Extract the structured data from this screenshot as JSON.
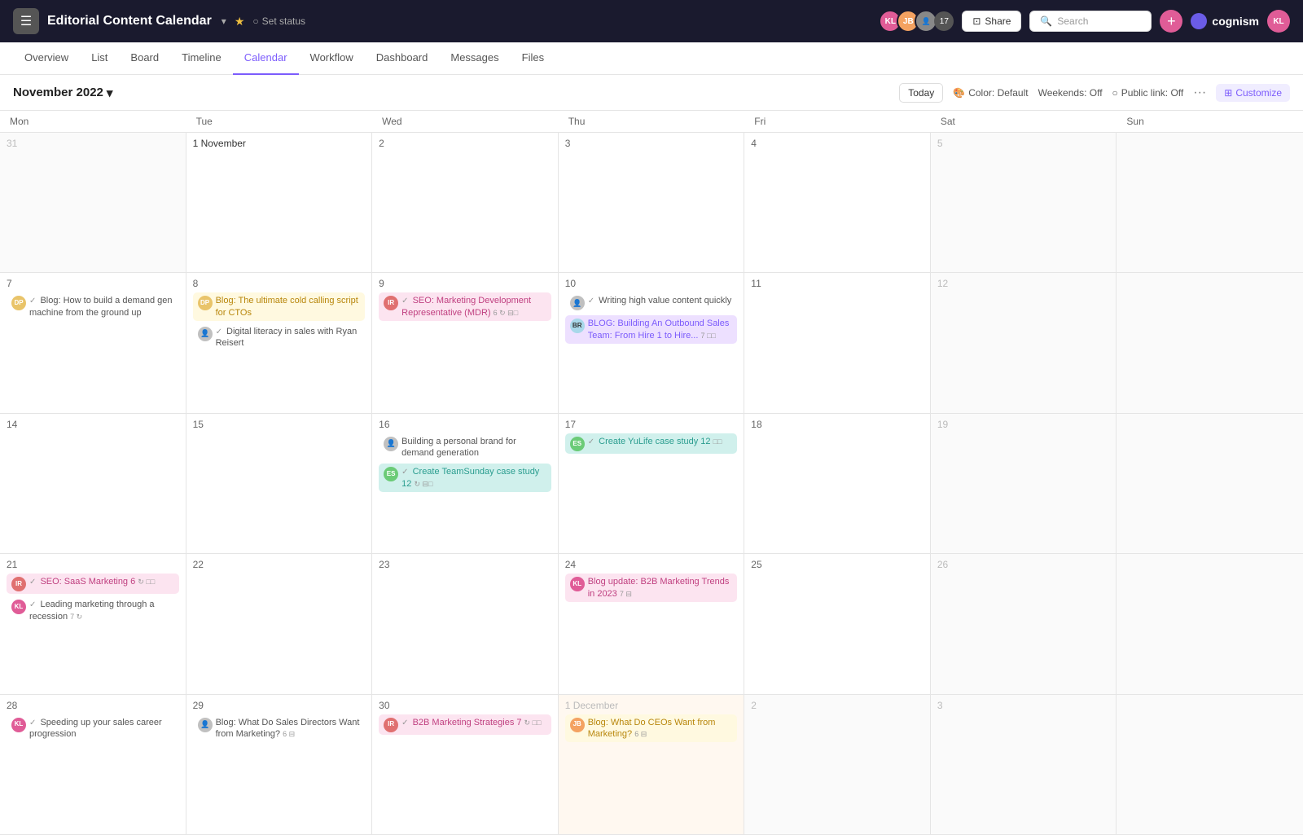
{
  "header": {
    "app_icon": "☰",
    "title": "Editorial Content Calendar",
    "set_status": "Set status",
    "star": "★",
    "share_label": "Share",
    "search_placeholder": "Search",
    "add_icon": "+",
    "brand_name": "cognism",
    "user_initials": "KL",
    "avatar_count": "17"
  },
  "nav": {
    "tabs": [
      "Overview",
      "List",
      "Board",
      "Timeline",
      "Calendar",
      "Workflow",
      "Dashboard",
      "Messages",
      "Files"
    ],
    "active": "Calendar"
  },
  "toolbar": {
    "month": "November 2022",
    "today": "Today",
    "color": "Color: Default",
    "weekends": "Weekends: Off",
    "public_link": "Public link: Off",
    "customize": "Customize"
  },
  "day_headers": [
    "Mon",
    "Tue",
    "Wed",
    "Thu",
    "Fri",
    "Sat",
    "Sun"
  ],
  "weeks": [
    {
      "days": [
        {
          "num": "31",
          "outside": true,
          "events": []
        },
        {
          "num": "1 November",
          "events": []
        },
        {
          "num": "2",
          "events": []
        },
        {
          "num": "3",
          "events": []
        },
        {
          "num": "4",
          "events": []
        },
        {
          "num": "5",
          "outside": true,
          "events": []
        },
        {
          "num": "",
          "outside": true,
          "events": []
        }
      ]
    },
    {
      "days": [
        {
          "num": "7",
          "events": [
            {
              "type": "plain",
              "avatar": "dp",
              "avatar_class": "av-dp",
              "text": "Blog: How to build a demand gen machine from the ground up",
              "check": true
            }
          ]
        },
        {
          "num": "8",
          "events": [
            {
              "type": "yellow",
              "avatar": "dp",
              "avatar_class": "av-dp",
              "text": "Blog: The ultimate cold calling script for CTOs",
              "check": false
            },
            {
              "type": "plain",
              "avatar": "photo",
              "text": "Digital literacy in sales with Ryan Reisert",
              "check": true
            }
          ]
        },
        {
          "num": "9",
          "events": [
            {
              "type": "pink",
              "avatar": "ir",
              "avatar_class": "av-ir",
              "text": "SEO: Marketing Development Representative (MDR)",
              "check": true,
              "num": "6",
              "icons": "⊟□"
            }
          ]
        },
        {
          "num": "10",
          "events": [
            {
              "type": "plain",
              "avatar": "photo",
              "text": "Writing high value content quickly",
              "check": true
            },
            {
              "type": "purple",
              "avatar": "br",
              "avatar_class": "av-br",
              "text": "BLOG: Building An Outbound Sales Team: From Hire 1 to Hire...",
              "check": false,
              "num": "7",
              "icons": "□□"
            }
          ]
        },
        {
          "num": "11",
          "events": []
        },
        {
          "num": "12",
          "outside": true,
          "events": []
        },
        {
          "num": "",
          "outside": true,
          "events": []
        }
      ]
    },
    {
      "days": [
        {
          "num": "14",
          "events": []
        },
        {
          "num": "15",
          "events": []
        },
        {
          "num": "16",
          "events": [
            {
              "type": "plain",
              "avatar": "photo",
              "text": "Building a personal brand for demand generation",
              "check": false
            },
            {
              "type": "teal",
              "avatar": "es",
              "avatar_class": "av-es",
              "text": "Create TeamSunday case study 12",
              "check": true,
              "icons": "⊟□"
            }
          ]
        },
        {
          "num": "17",
          "events": [
            {
              "type": "teal",
              "avatar": "es",
              "avatar_class": "av-es",
              "text": "Create YuLife case study 12",
              "check": true,
              "icons": "□□"
            }
          ]
        },
        {
          "num": "18",
          "events": []
        },
        {
          "num": "19",
          "outside": true,
          "events": []
        },
        {
          "num": "",
          "outside": true,
          "events": []
        }
      ]
    },
    {
      "days": [
        {
          "num": "21",
          "events": [
            {
              "type": "pink",
              "avatar": "ir",
              "avatar_class": "av-ir",
              "text": "SEO: SaaS Marketing 6",
              "check": true,
              "icons": "□□"
            },
            {
              "type": "plain",
              "avatar": "kl",
              "avatar_class": "av-kl",
              "text": "Leading marketing through a recession",
              "check": true,
              "num": "7",
              "icons": "↻"
            }
          ]
        },
        {
          "num": "22",
          "events": []
        },
        {
          "num": "23",
          "events": []
        },
        {
          "num": "24",
          "events": [
            {
              "type": "pink",
              "avatar": "kl",
              "avatar_class": "av-kl",
              "text": "Blog update: B2B Marketing Trends in 2023",
              "check": false,
              "num": "7",
              "icons": "⊟"
            }
          ]
        },
        {
          "num": "25",
          "events": []
        },
        {
          "num": "26",
          "outside": true,
          "events": []
        },
        {
          "num": "",
          "outside": true,
          "events": []
        }
      ]
    },
    {
      "days": [
        {
          "num": "28",
          "events": [
            {
              "type": "plain",
              "avatar": "kl",
              "avatar_class": "av-kl",
              "text": "Speeding up your sales career progression",
              "check": true
            }
          ]
        },
        {
          "num": "29",
          "events": [
            {
              "type": "plain",
              "avatar": "photo",
              "text": "Blog: What Do Sales Directors Want from Marketing?",
              "check": false,
              "num": "6",
              "icons": "⊟"
            }
          ]
        },
        {
          "num": "30",
          "events": [
            {
              "type": "pink",
              "avatar": "ir",
              "avatar_class": "av-ir",
              "text": "B2B Marketing Strategies 7",
              "check": true,
              "icons": "□□"
            }
          ]
        },
        {
          "num": "1 December",
          "outside": true,
          "events": [
            {
              "type": "yellow",
              "avatar": "jb",
              "avatar_class": "av-jb",
              "text": "Blog: What Do CEOs Want from Marketing?",
              "check": false,
              "num": "6",
              "icons": "⊟"
            }
          ]
        },
        {
          "num": "2",
          "outside": true,
          "events": []
        },
        {
          "num": "3",
          "outside": true,
          "events": []
        },
        {
          "num": "",
          "outside": true,
          "events": []
        }
      ]
    }
  ],
  "avatars": {
    "kl": "KL",
    "jb": "JB",
    "dp": "DP",
    "ir": "IR",
    "br": "BR",
    "es": "ES"
  }
}
